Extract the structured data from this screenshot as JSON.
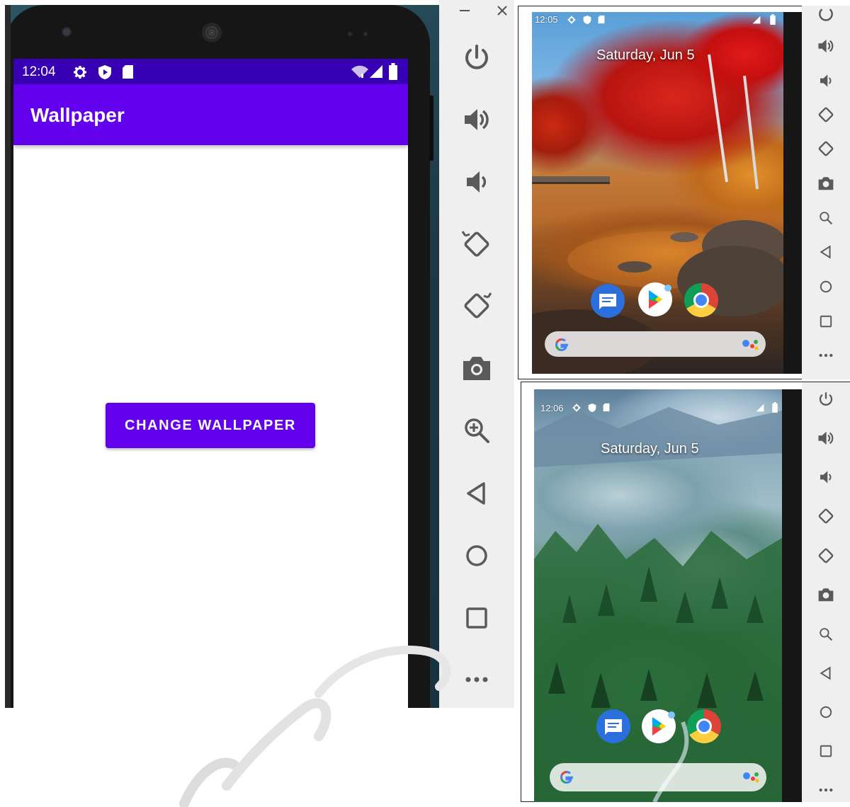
{
  "main_emulator": {
    "status_time": "12:04",
    "app_title": "Wallpaper",
    "button_label": "CHANGE WALLPAPER",
    "colors": {
      "status_bar": "#3700b3",
      "toolbar": "#6200ee",
      "button": "#6200ee"
    },
    "toolbar_icons": [
      "power-icon",
      "volume-up-icon",
      "volume-down-icon",
      "rotate-left-icon",
      "rotate-right-icon",
      "camera-icon",
      "zoom-icon",
      "back-icon",
      "home-icon",
      "overview-icon",
      "more-icon"
    ]
  },
  "top_right_emulator": {
    "status_time": "12:05",
    "date": "Saturday, Jun 5"
  },
  "bottom_right_emulator": {
    "status_time": "12:06",
    "date": "Saturday, Jun 5"
  }
}
